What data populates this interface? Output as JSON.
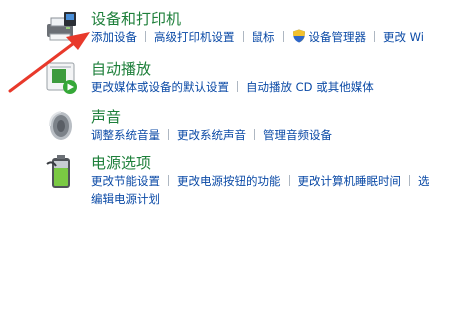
{
  "sections": [
    {
      "title": "设备和打印机",
      "icon": "printer-icon",
      "links": [
        "添加设备",
        "高级打印机设置",
        "鼠标",
        "设备管理器",
        "更改 Wi"
      ]
    },
    {
      "title": "自动播放",
      "icon": "autoplay-icon",
      "links": [
        "更改媒体或设备的默认设置",
        "自动播放 CD 或其他媒体"
      ]
    },
    {
      "title": "声音",
      "icon": "speaker-icon",
      "links": [
        "调整系统音量",
        "更改系统声音",
        "管理音频设备"
      ]
    },
    {
      "title": "电源选项",
      "icon": "battery-icon",
      "links": [
        "更改节能设置",
        "更改电源按钮的功能",
        "更改计算机睡眠时间",
        "选"
      ],
      "links_row2": [
        "编辑电源计划"
      ]
    }
  ],
  "annotation": {
    "icon": "red-arrow-annotation",
    "color": "#e8392b"
  },
  "colors": {
    "title": "#1d7f3a",
    "link": "#0b4aa6",
    "separator": "#aeb7c2"
  }
}
